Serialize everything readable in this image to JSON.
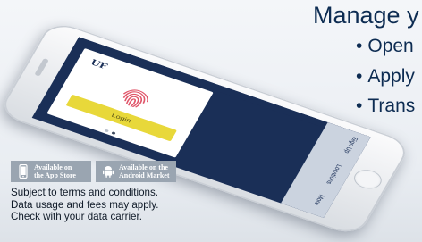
{
  "headline": "Manage y",
  "bullets": [
    {
      "bullet": "•",
      "text": "Open"
    },
    {
      "bullet": "•",
      "text": "Apply"
    },
    {
      "bullet": "•",
      "text": "Trans"
    }
  ],
  "phone": {
    "logo_text": "UF",
    "login_button": "Login",
    "tabs": [
      {
        "label": "Sign Up"
      },
      {
        "label": "Locations"
      },
      {
        "label": "More"
      }
    ],
    "accent_color": "#e8d83a",
    "screen_color": "#1a2f57"
  },
  "badges": [
    {
      "icon": "phone-icon",
      "line1": "Available on",
      "line2": "the App Store"
    },
    {
      "icon": "android-icon",
      "line1": "Available on the",
      "line2": "Android Market"
    }
  ],
  "disclaimer": [
    "Subject to terms and conditions.",
    "Data usage and fees may apply.",
    "Check with your data carrier."
  ]
}
